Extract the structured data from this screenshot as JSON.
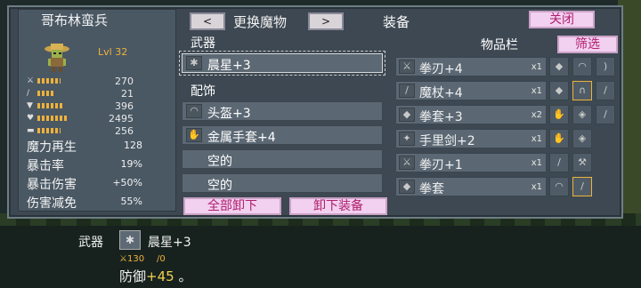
{
  "character": {
    "name": "哥布林蛮兵",
    "level": "Lvl 32",
    "stats": [
      {
        "icon": "sword-icon",
        "value": "270"
      },
      {
        "icon": "wand-icon",
        "value": "21"
      },
      {
        "icon": "shield-icon",
        "value": "396"
      },
      {
        "icon": "heart-icon",
        "value": "2495"
      },
      {
        "icon": "boot-icon",
        "value": "256"
      }
    ],
    "extra": [
      {
        "label": "魔力再生",
        "value": "128"
      },
      {
        "label": "暴击率",
        "value": "19%"
      },
      {
        "label": "暴击伤害",
        "value": "+50%"
      },
      {
        "label": "伤害减免",
        "value": "55%"
      }
    ]
  },
  "header": {
    "prev": "<",
    "change": "更换魔物",
    "next": ">",
    "title": "装备",
    "close": "关闭"
  },
  "equip": {
    "weapon_section": "武器",
    "weapon": {
      "icon": "morningstar-icon",
      "label": "晨星+3"
    },
    "accessory_section": "配饰",
    "accessories": [
      {
        "icon": "helmet-icon",
        "label": "头盔+3"
      },
      {
        "icon": "gauntlet-icon",
        "label": "金属手套+4"
      },
      {
        "icon": "",
        "label": "空的"
      },
      {
        "icon": "",
        "label": "空的"
      }
    ],
    "unequip_all": "全部卸下",
    "unequip": "卸下装备"
  },
  "inventory": {
    "title": "物品栏",
    "filter": "筛选",
    "items": [
      {
        "icon": "fist-blade-icon",
        "label": "拳刃+4",
        "qty": "x1"
      },
      {
        "icon": "staff-icon",
        "label": "魔杖+4",
        "qty": "x1"
      },
      {
        "icon": "knuckle-icon",
        "label": "拳套+3",
        "qty": "x2"
      },
      {
        "icon": "shuriken-icon",
        "label": "手里剑+2",
        "qty": "x1"
      },
      {
        "icon": "fist-blade-icon",
        "label": "拳刃+1",
        "qty": "x1"
      },
      {
        "icon": "knuckle-icon",
        "label": "拳套",
        "qty": "x1"
      }
    ]
  },
  "detail": {
    "slot": "武器",
    "icon": "morningstar-icon",
    "name": "晨星+3",
    "atk": "130",
    "mag": "0",
    "defense_label": "防御",
    "defense_value": "+45",
    "end": "。"
  }
}
